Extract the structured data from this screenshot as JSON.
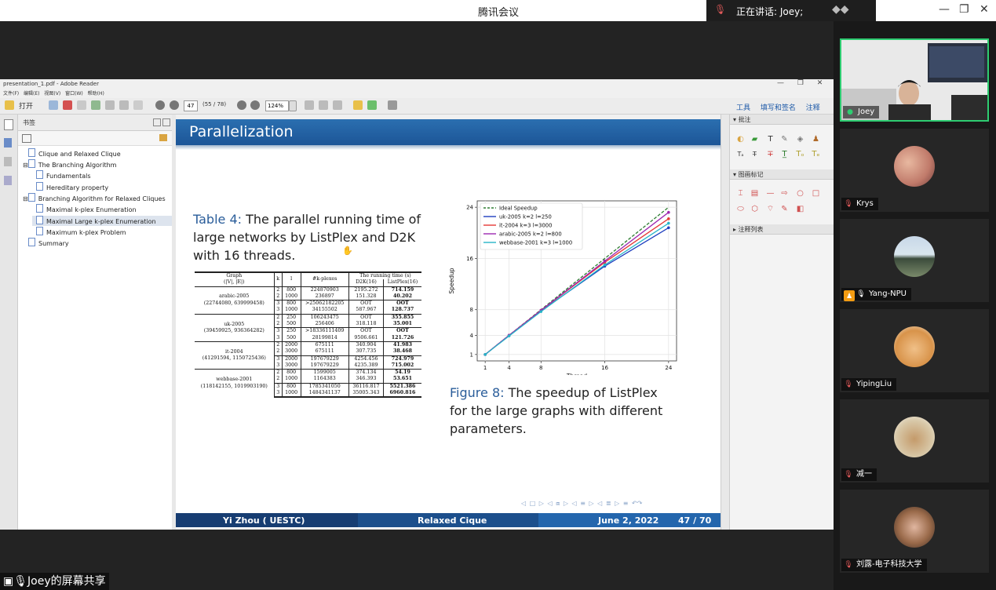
{
  "meeting": {
    "app_title": "腾讯会议",
    "speaker_text": "正在讲话: Joey;",
    "window_controls": [
      "—",
      "❐",
      "✕"
    ],
    "sharer_label": "Joey的屏幕共享"
  },
  "reader": {
    "window_title": "presentation_1.pdf - Adobe Reader",
    "menu": "文件(F) 编辑(E) 视图(V) 窗口(W) 帮助(H)",
    "open_label": "打开",
    "page_input": "47",
    "page_count": "(55 / 78)",
    "zoom": "124%",
    "right_links": "工具 填写和签名 注释",
    "bookmarks_title": "书签",
    "bookmarks": [
      {
        "label": "Clique and Relaxed Clique",
        "level": 0,
        "selected": false
      },
      {
        "label": "The Branching Algorithm",
        "level": 0,
        "selected": false
      },
      {
        "label": "Fundamentals",
        "level": 1,
        "selected": false
      },
      {
        "label": "Hereditary property",
        "level": 1,
        "selected": false
      },
      {
        "label": "Branching Algorithm for Relaxed Cliques",
        "level": 0,
        "selected": false
      },
      {
        "label": "Maximal k-plex Enumeration",
        "level": 1,
        "selected": false
      },
      {
        "label": "Maximal Large k-plex Enumeration",
        "level": 1,
        "selected": true
      },
      {
        "label": "Maximum k-plex Problem",
        "level": 1,
        "selected": false
      },
      {
        "label": "Summary",
        "level": 0,
        "selected": false
      }
    ],
    "comment_sections": [
      "批注",
      "图画标记",
      "注释列表"
    ]
  },
  "slide": {
    "title": "Parallelization",
    "table_caption_label": "Table 4:",
    "table_caption_text": "The parallel running time of large networks by ListPlex and D2K with 16 threads.",
    "figure_caption_label": "Figure 8:",
    "figure_caption_text": "The speedup of ListPlex for the large graphs with different parameters.",
    "footer_author": "Yi Zhou  ( UESTC)",
    "footer_title": "Relaxed Cique",
    "footer_date": "June 2, 2022",
    "footer_page": "47 / 70",
    "table": {
      "headers": {
        "graph": "Graph",
        "graph_sub": "(|V|, |E|)",
        "k": "k",
        "l": "l",
        "plexes": "#k-plexes",
        "time_group": "The running time (s)",
        "d2k": "D2K(16)",
        "listplex": "ListPlex(16)"
      },
      "groups": [
        {
          "name": "arabic-2005",
          "size": "(22744080, 639999458)",
          "rows": [
            {
              "k": "2",
              "l": "800",
              "plexes": "224870903",
              "d2k": "2195.272",
              "lp": "714.159"
            },
            {
              "k": "2",
              "l": "1000",
              "plexes": "236897",
              "d2k": "151.328",
              "lp": "40.202"
            },
            {
              "k": "3",
              "l": "800",
              "plexes": ">25062182205",
              "d2k": "OOT",
              "lp": "OOT"
            },
            {
              "k": "3",
              "l": "1000",
              "plexes": "34155502",
              "d2k": "587.967",
              "lp": "128.737"
            }
          ]
        },
        {
          "name": "uk-2005",
          "size": "(39459925, 936364282)",
          "rows": [
            {
              "k": "2",
              "l": "250",
              "plexes": "106243475",
              "d2k": "OOT",
              "lp": "355.855"
            },
            {
              "k": "2",
              "l": "500",
              "plexes": "256406",
              "d2k": "318.118",
              "lp": "35.001"
            },
            {
              "k": "3",
              "l": "250",
              "plexes": ">18336111409",
              "d2k": "OOT",
              "lp": "OOT"
            },
            {
              "k": "3",
              "l": "500",
              "plexes": "28199814",
              "d2k": "9506.661",
              "lp": "121.726"
            }
          ]
        },
        {
          "name": "it-2004",
          "size": "(41291594, 1150725436)",
          "rows": [
            {
              "k": "2",
              "l": "2000",
              "plexes": "675111",
              "d2k": "340.904",
              "lp": "41.983"
            },
            {
              "k": "2",
              "l": "3000",
              "plexes": "675111",
              "d2k": "307.735",
              "lp": "38.468"
            },
            {
              "k": "3",
              "l": "2000",
              "plexes": "197679229",
              "d2k": "4254.456",
              "lp": "724.979"
            },
            {
              "k": "3",
              "l": "3000",
              "plexes": "197679229",
              "d2k": "4235.389",
              "lp": "715.002"
            }
          ]
        },
        {
          "name": "webbase-2001",
          "size": "(118142155, 1019903190)",
          "rows": [
            {
              "k": "2",
              "l": "800",
              "plexes": "1599005",
              "d2k": "374.134",
              "lp": "54.19"
            },
            {
              "k": "2",
              "l": "1000",
              "plexes": "1164383",
              "d2k": "346.393",
              "lp": "53.651"
            },
            {
              "k": "3",
              "l": "800",
              "plexes": "1785341050",
              "d2k": "36116.817",
              "lp": "5521.386"
            },
            {
              "k": "3",
              "l": "1000",
              "plexes": "1484341137",
              "d2k": "35005.343",
              "lp": "6960.816"
            }
          ]
        }
      ]
    }
  },
  "chart_data": {
    "type": "line",
    "title": "",
    "xlabel": "Thread",
    "ylabel": "Speedup",
    "x": [
      1,
      4,
      8,
      16,
      24
    ],
    "xticks": [
      1,
      4,
      8,
      16,
      24
    ],
    "yticks": [
      1,
      4,
      8,
      16,
      24
    ],
    "xlim": [
      0,
      25
    ],
    "ylim": [
      0,
      25
    ],
    "grid": true,
    "legend_position": "top-left",
    "series": [
      {
        "name": "Ideal Speedup",
        "values": [
          1,
          4,
          8,
          16,
          24
        ],
        "color": "#2e7d32",
        "dash": true
      },
      {
        "name": "uk-2005 k=2 l=250",
        "values": [
          1,
          4,
          7.8,
          14.8,
          20.8
        ],
        "color": "#1f3fbf"
      },
      {
        "name": "it-2004 k=3 l=3000",
        "values": [
          1,
          4,
          7.9,
          15.4,
          22.2
        ],
        "color": "#e53935"
      },
      {
        "name": "arabic-2005 k=2 l=800",
        "values": [
          1,
          4,
          7.9,
          15.6,
          23.2
        ],
        "color": "#9c27b0"
      },
      {
        "name": "webbase-2001 k=3 l=1000",
        "values": [
          1,
          3.9,
          7.7,
          15.0,
          21.5
        ],
        "color": "#26b5c8"
      }
    ]
  },
  "participants": [
    {
      "name": "Joey",
      "active": true,
      "muted": false,
      "host": false
    },
    {
      "name": "Krys",
      "active": false,
      "muted": true,
      "host": false
    },
    {
      "name": "Yang-NPU",
      "active": false,
      "muted": false,
      "host": true
    },
    {
      "name": "YipingLiu",
      "active": false,
      "muted": true,
      "host": false
    },
    {
      "name": "减一",
      "active": false,
      "muted": true,
      "host": false
    },
    {
      "name": "刘露-电子科技大学",
      "active": false,
      "muted": true,
      "host": false
    }
  ]
}
